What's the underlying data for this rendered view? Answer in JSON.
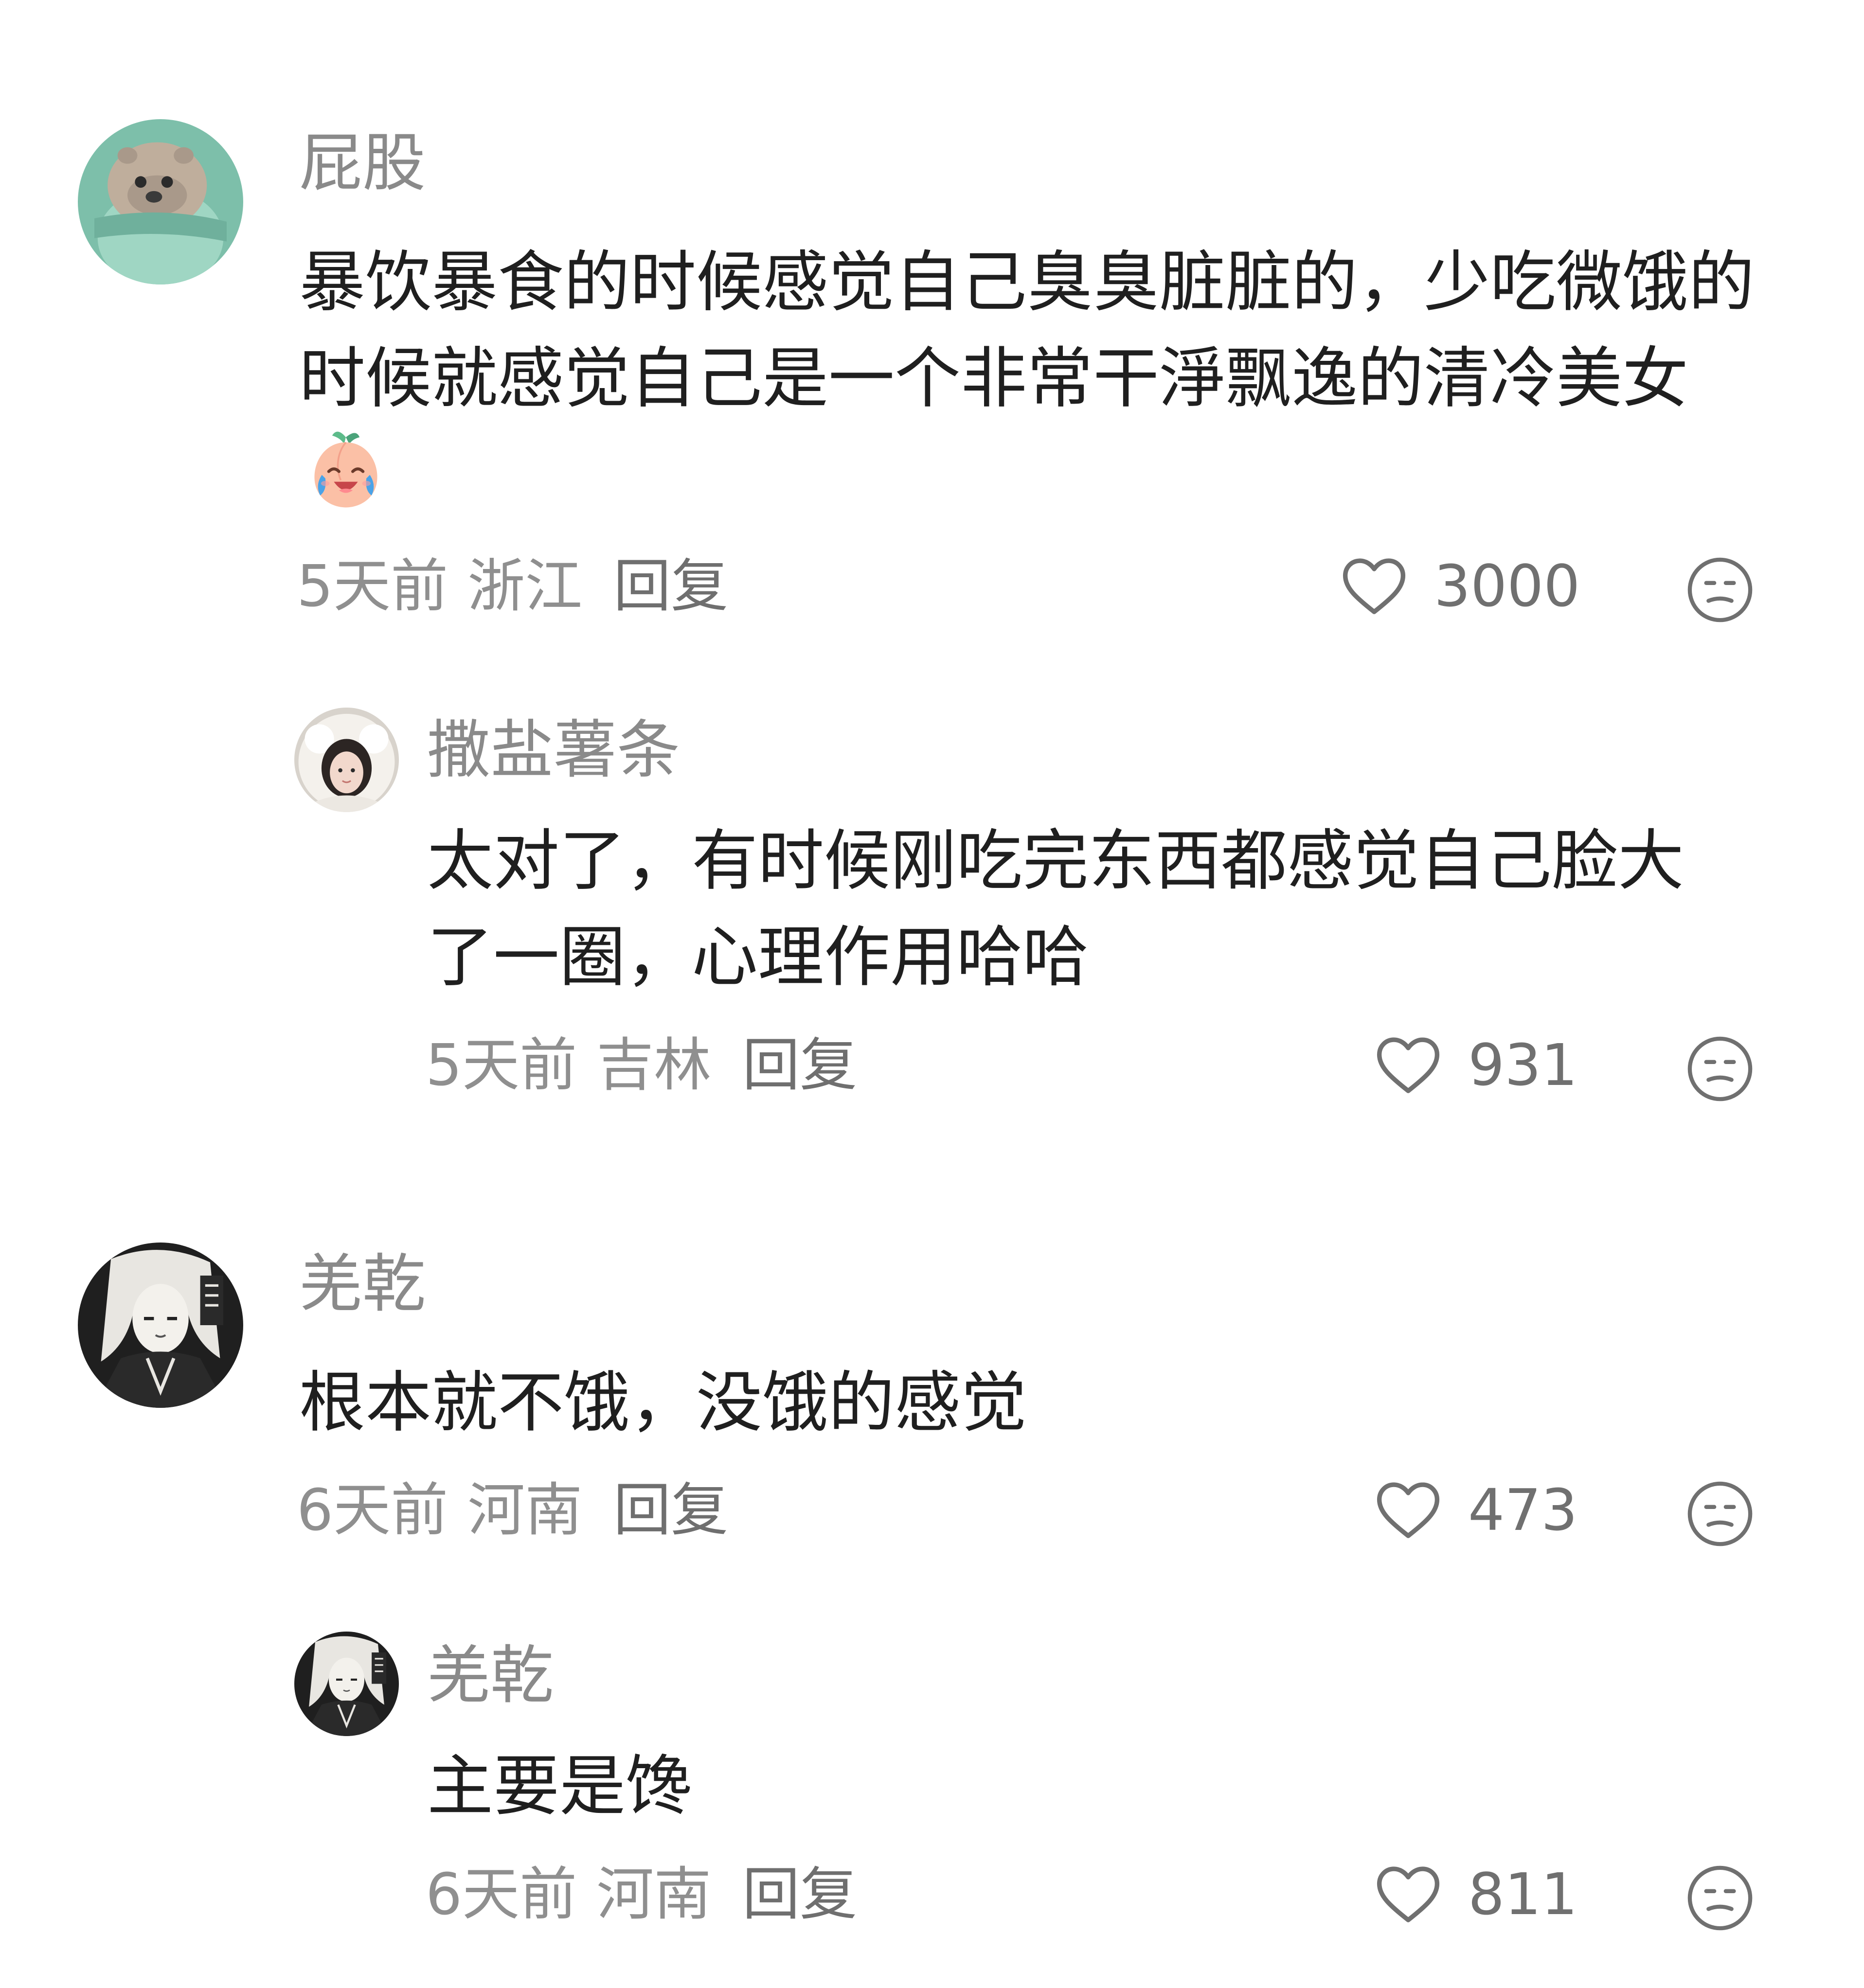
{
  "comments": [
    {
      "username": "屁股",
      "text": "暴饮暴食的时候感觉自己臭臭脏脏的，少吃微饿的时候就感觉自己是一个非常干淨飘逸的清冷美女",
      "emoji": "crying-laughing-peach-emoji",
      "time": "5天前",
      "location": "浙江",
      "reply_label": "回复",
      "likes": "3000",
      "avatar": "otter-avatar",
      "replies": [
        {
          "username": "撒盐薯条",
          "text": "太对了，有时候刚吃完东西都感觉自己脸大了一圈，心理作用哈哈",
          "time": "5天前",
          "location": "吉林",
          "reply_label": "回复",
          "likes": "931",
          "avatar": "girl-hood-avatar"
        }
      ]
    },
    {
      "username": "羌乾",
      "text": "根本就不饿，没饿的感觉",
      "time": "6天前",
      "location": "河南",
      "reply_label": "回复",
      "likes": "473",
      "avatar": "anime-girl-avatar",
      "replies": [
        {
          "username": "羌乾",
          "text": "主要是馋",
          "time": "6天前",
          "location": "河南",
          "reply_label": "回复",
          "likes": "811",
          "avatar": "anime-girl-avatar"
        }
      ]
    }
  ],
  "icons": {
    "like": "heart-outline-icon",
    "dislike": "meh-face-icon"
  },
  "colors": {
    "username": "#8a8a8a",
    "text": "#1f1f1f",
    "meta": "#8f8f8f"
  }
}
